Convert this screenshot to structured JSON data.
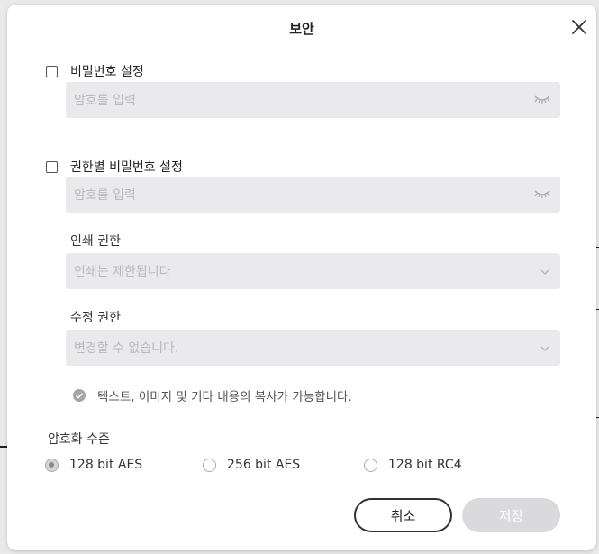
{
  "dialog": {
    "title": "보안",
    "password": {
      "label": "비밀번호 설정",
      "placeholder": "암호를 입력"
    },
    "permission_password": {
      "label": "권한별 비밀번호 설정",
      "placeholder": "암호를 입력"
    },
    "print_permission": {
      "label": "인쇄 권한",
      "value": "인쇄는 제한됩니다"
    },
    "edit_permission": {
      "label": "수정 권한",
      "value": "변경할 수 없습니다."
    },
    "copy_note": "텍스트, 이미지 및 기타 내용의 복사가 가능합니다.",
    "encryption": {
      "label": "암호화 수준",
      "options": [
        "128 bit AES",
        "256 bit AES",
        "128 bit RC4"
      ],
      "selected": "128 bit AES"
    },
    "buttons": {
      "cancel": "취소",
      "save": "저장"
    }
  },
  "icons": {
    "close": "close-icon",
    "eye_hidden": "eye-closed-icon",
    "dropdown": "chevron-down-icon",
    "check": "check-circle-icon"
  },
  "colors": {
    "field_bg": "#eaeaec",
    "placeholder": "#b9b9bd",
    "save_disabled": "#dadadc"
  }
}
